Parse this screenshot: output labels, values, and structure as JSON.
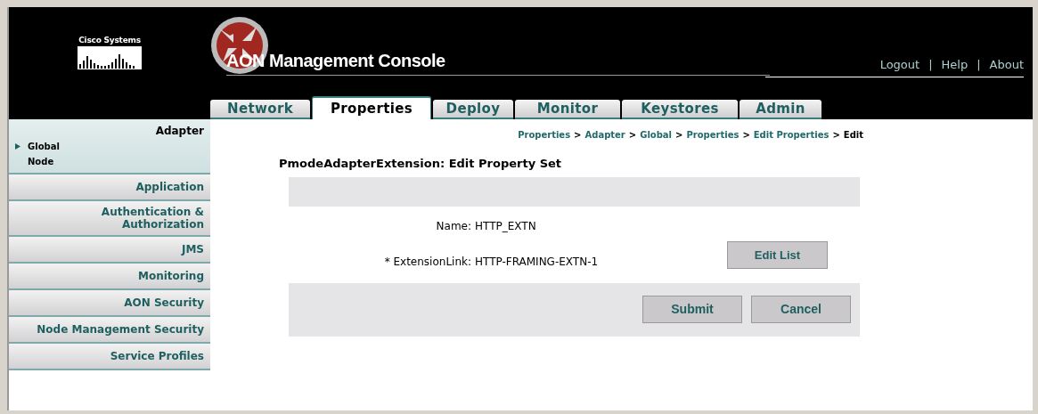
{
  "header": {
    "brand": "Cisco Systems",
    "title": "AON Management Console",
    "links": [
      "Logout",
      "Help",
      "About"
    ],
    "separator": "|"
  },
  "tabs": [
    {
      "label": "Network",
      "selected": false
    },
    {
      "label": "Properties",
      "selected": true
    },
    {
      "label": "Deploy",
      "selected": false
    },
    {
      "label": "Monitor",
      "selected": false
    },
    {
      "label": "Keystores",
      "selected": false
    },
    {
      "label": "Admin",
      "selected": false
    }
  ],
  "sidebar": {
    "items": [
      {
        "label": "Adapter",
        "expanded": true,
        "children": [
          {
            "label": "Global",
            "selected": true
          },
          {
            "label": "Node",
            "selected": false
          }
        ]
      },
      {
        "label": "Application",
        "expanded": false
      },
      {
        "label": "Authentication & Authorization",
        "expanded": false
      },
      {
        "label": "JMS",
        "expanded": false
      },
      {
        "label": "Monitoring",
        "expanded": false
      },
      {
        "label": "AON Security",
        "expanded": false
      },
      {
        "label": "Node Management Security",
        "expanded": false
      },
      {
        "label": "Service Profiles",
        "expanded": false
      }
    ]
  },
  "breadcrumb": {
    "separator": ">",
    "items": [
      {
        "label": "Properties",
        "current": false
      },
      {
        "label": "Adapter",
        "current": false
      },
      {
        "label": "Global",
        "current": false
      },
      {
        "label": "Properties",
        "current": false
      },
      {
        "label": "Edit Properties",
        "current": false
      },
      {
        "label": "Edit",
        "current": true
      }
    ]
  },
  "form": {
    "heading": "PmodeAdapterExtension: Edit Property Set",
    "fields": [
      {
        "label": "Name:",
        "value": "HTTP_EXTN"
      },
      {
        "label": "* ExtensionLink:",
        "value": "HTTP-FRAMING-EXTN-1",
        "button": "Edit List"
      }
    ],
    "buttons": [
      "Submit",
      "Cancel"
    ]
  }
}
